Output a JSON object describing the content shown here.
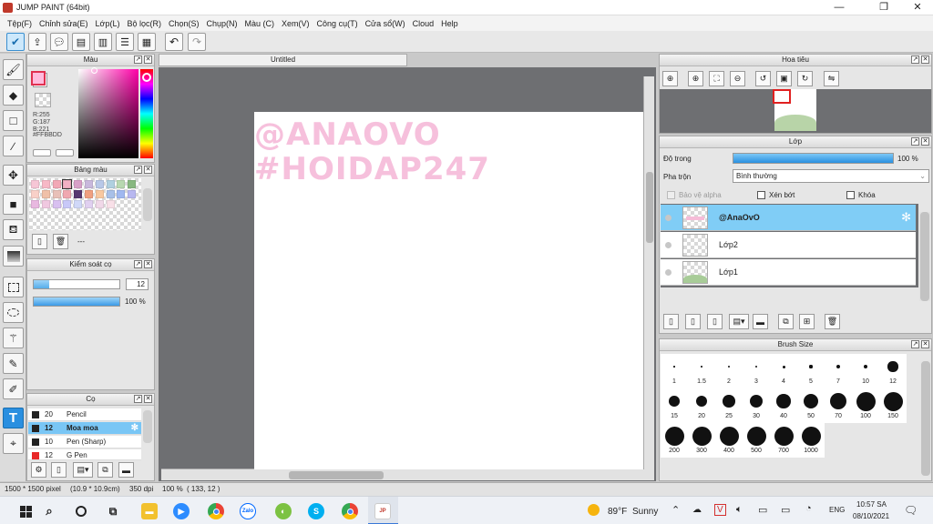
{
  "window": {
    "title": "JUMP PAINT (64bit)",
    "minimize": "—",
    "restore": "❐",
    "close": "✕"
  },
  "menu": [
    "Tệp(F)",
    "Chỉnh sửa(E)",
    "Lớp(L)",
    "Bộ lọc(R)",
    "Chọn(S)",
    "Chụp(N)",
    "Màu (C)",
    "Xem(V)",
    "Công cụ(T)",
    "Cửa sổ(W)",
    "Cloud",
    "Help"
  ],
  "color_panel": {
    "title": "Màu",
    "readout_r": "R:255",
    "readout_g": "G:187",
    "readout_b": "B:221",
    "hex": "#FFBBDD",
    "fg_color": "#ffbbdd",
    "hue_color": "#ff00a8"
  },
  "palette_panel": {
    "title": "Bảng màu",
    "swatches": [
      "#f6c6d6",
      "#f7b8c6",
      "#f2a8b6",
      "#f2b0c4",
      "#d8a0c8",
      "#c8b8dc",
      "#b8c8e8",
      "#b0d0e0",
      "#b8d8b0",
      "#88b880",
      "#f8d0c8",
      "#f0c0a8",
      "#e8c0b8",
      "#f0a8b0",
      "#583870",
      "#f0a080",
      "#f8c8a0",
      "#a8c0e8",
      "#a0b8f0",
      "#b8b8f0",
      "#e8b8e0",
      "#f0c8e0",
      "#d8c0f0",
      "#c8c8f8",
      "#d0d8f8",
      "#e0d0f0",
      "#f0d8e8",
      "#f8e0e8",
      "",
      ""
    ],
    "footer": "---"
  },
  "brush_control": {
    "title": "Kiểm soát cọ",
    "size": "12",
    "opacity": "100 %",
    "size_fraction": 0.18,
    "opacity_fraction": 1.0
  },
  "brush_panel": {
    "title": "Cọ",
    "items": [
      {
        "size": "20",
        "name": "Pencil",
        "color": "#222222"
      },
      {
        "size": "12",
        "name": "Moa moa",
        "color": "#222222"
      },
      {
        "size": "10",
        "name": "Pen (Sharp)",
        "color": "#222222"
      },
      {
        "size": "12",
        "name": "G Pen",
        "color": "#e82828"
      }
    ]
  },
  "document": {
    "tab": "Untitled",
    "watermark_line1": "@ANAOVO",
    "watermark_line2": "#HOIDAP247"
  },
  "navigator": {
    "title": "Hoa tiêu"
  },
  "layer_panel": {
    "title": "Lớp",
    "opacity_label": "Độ trong",
    "opacity_value": "100 %",
    "opacity_fraction": 1.0,
    "blend_label": "Pha trộn",
    "blend_value": "Bình thường",
    "protect_alpha": "Bảo vệ alpha",
    "clipping": "Xén bớt",
    "lock": "Khóa",
    "layers": [
      {
        "name": "@AnaOvO",
        "selected": true
      },
      {
        "name": "Lớp2",
        "selected": false
      },
      {
        "name": "Lớp1",
        "selected": false
      }
    ]
  },
  "brush_size": {
    "title": "Brush Size",
    "sizes": [
      "1",
      "1.5",
      "2",
      "3",
      "4",
      "5",
      "7",
      "10",
      "12",
      "15",
      "20",
      "25",
      "30",
      "40",
      "50",
      "70",
      "100",
      "150",
      "200",
      "300",
      "400",
      "500",
      "700",
      "1000"
    ]
  },
  "status": {
    "canvas_info": "1500 * 1500 pixel",
    "canvas_cm": "(10.9 * 10.9cm)",
    "dpi": "350 dpi",
    "zoom": "100 %",
    "coords": "( 133, 12 )"
  },
  "taskbar": {
    "weather_temp": "89°F",
    "weather_desc": "Sunny",
    "lang": "ENG",
    "time": "10:57 SA",
    "date": "08/10/2021"
  }
}
